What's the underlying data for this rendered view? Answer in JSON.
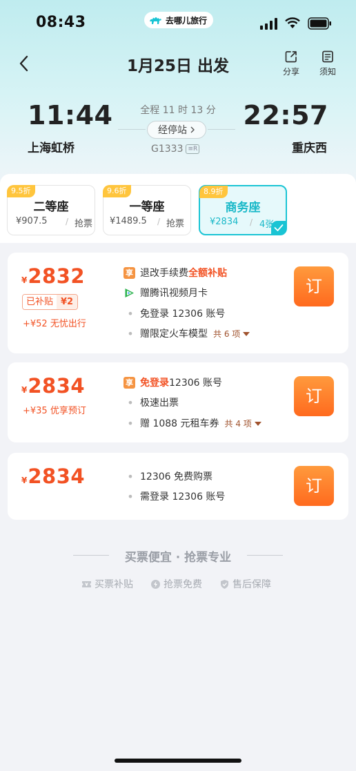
{
  "status_bar": {
    "time": "08:43",
    "brand": "去哪儿旅行"
  },
  "nav": {
    "title": "1月25日 出发",
    "share_label": "分享",
    "notice_label": "须知"
  },
  "journey": {
    "departure_time": "11:44",
    "departure_station": "上海虹桥",
    "arrival_time": "22:57",
    "arrival_station": "重庆西",
    "duration": "全程 11 时 13 分",
    "stops_label": "经停站",
    "train_number": "G1333",
    "train_badge": "≡R"
  },
  "seat_tabs": [
    {
      "discount": "9.5折",
      "name": "二等座",
      "price": "¥907.5",
      "sep": "/",
      "availability": "抢票",
      "selected": false
    },
    {
      "discount": "9.6折",
      "name": "一等座",
      "price": "¥1489.5",
      "sep": "/",
      "availability": "抢票",
      "selected": false
    },
    {
      "discount": "8.9折",
      "name": "商务座",
      "price": "¥2834",
      "sep": "/",
      "availability": "4张",
      "selected": true
    }
  ],
  "tickets": [
    {
      "currency": "¥",
      "price": "2832",
      "subsidy_label": "已补贴",
      "subsidy_amount": "¥2",
      "extra": "+¥52 无忧出行",
      "features": {
        "f1_prefix": "退改手续费",
        "f1_highlight": "全额补贴",
        "f2": "赠腾讯视频月卡",
        "f3": "免登录 12306 账号",
        "f4": "赠限定火车模型",
        "f4_more": "共 6 项"
      },
      "book_label": "订"
    },
    {
      "currency": "¥",
      "price": "2834",
      "extra": "+¥35 优享预订",
      "features": {
        "f1_highlight": "免登录",
        "f1_suffix": " 12306 账号",
        "f2": "极速出票",
        "f3": "赠 1088 元租车券",
        "f3_more": "共 4 项"
      },
      "book_label": "订"
    },
    {
      "currency": "¥",
      "price": "2834",
      "features": {
        "f1": "12306 免费购票",
        "f2": "需登录 12306 账号"
      },
      "book_label": "订"
    }
  ],
  "footer": {
    "slogan": "买票便宜 · 抢票专业",
    "guarantees": [
      "买票补贴",
      "抢票免费",
      "售后保障"
    ]
  },
  "colors": {
    "accent_teal": "#19c4d4",
    "price_orange": "#f25224",
    "book_button": "#ff7a26",
    "discount_badge": "#ffc53d"
  }
}
